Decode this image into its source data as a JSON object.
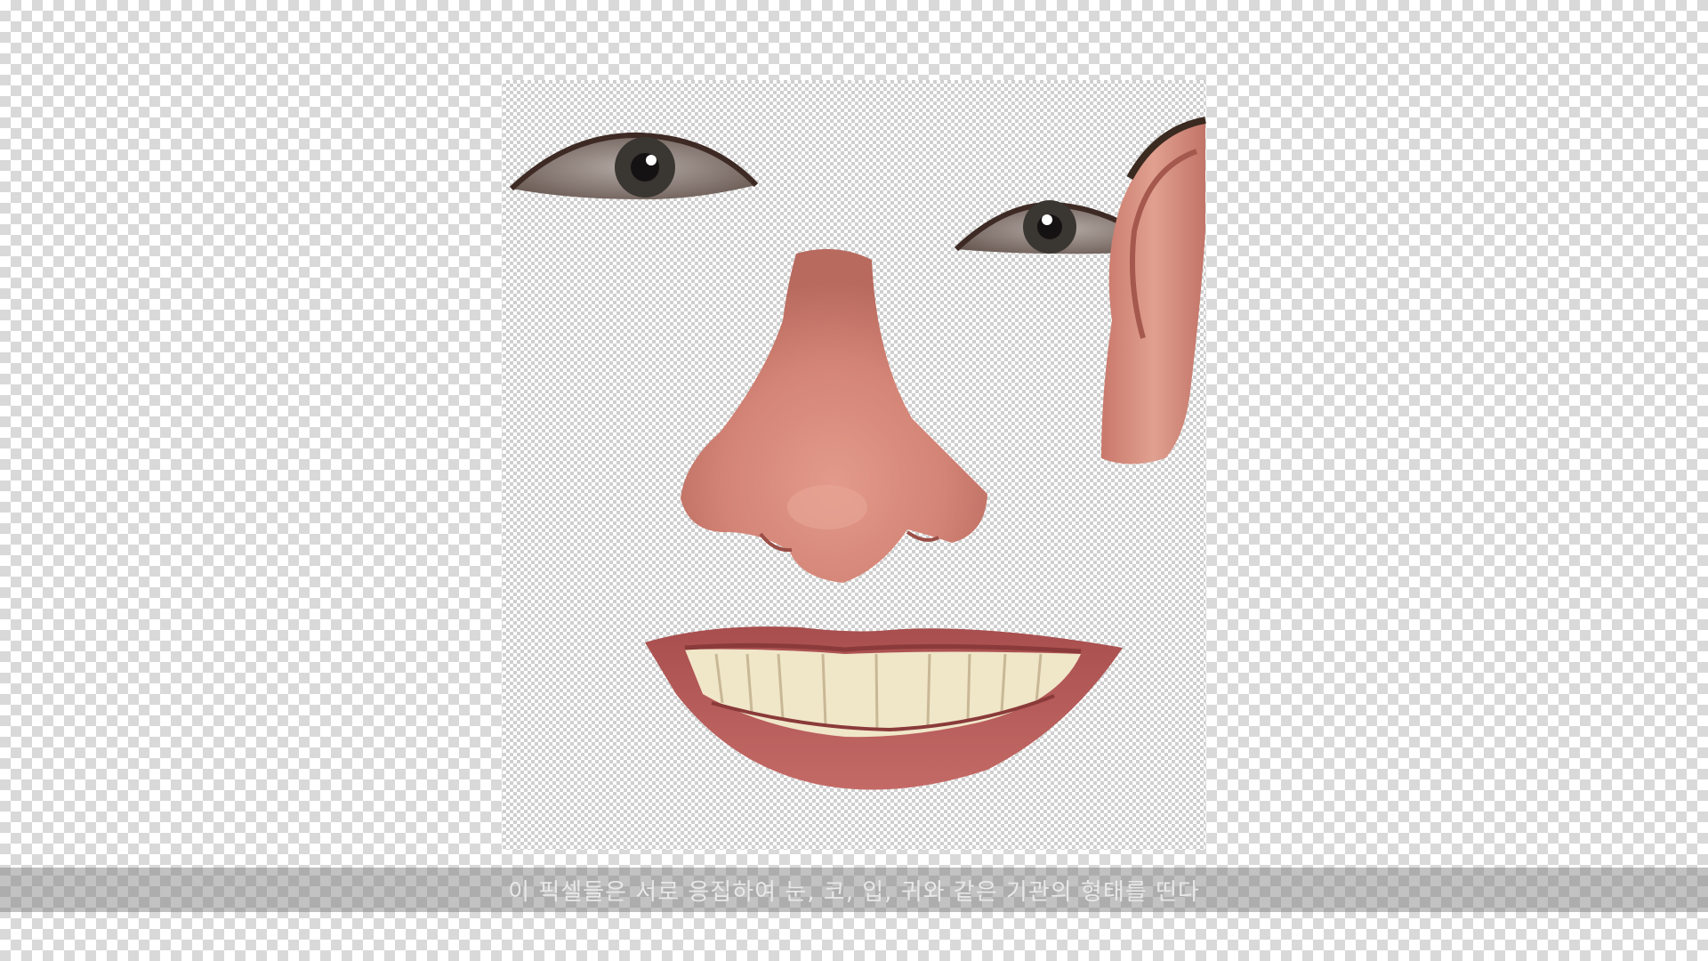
{
  "caption": {
    "text": "이 픽셀들은 서로 응집하여 눈, 코, 입, 귀와 같은 기관의 형태를 띤다"
  },
  "colors": {
    "skin": "#d8887a",
    "skin_dark": "#b4645a",
    "lip": "#b35a5a",
    "teeth": "#f0e6c8",
    "iris": "#3a3632",
    "caption_bg": "#7a7a7a"
  },
  "parts": [
    "left-eye",
    "right-eye",
    "nose",
    "mouth",
    "ear"
  ]
}
